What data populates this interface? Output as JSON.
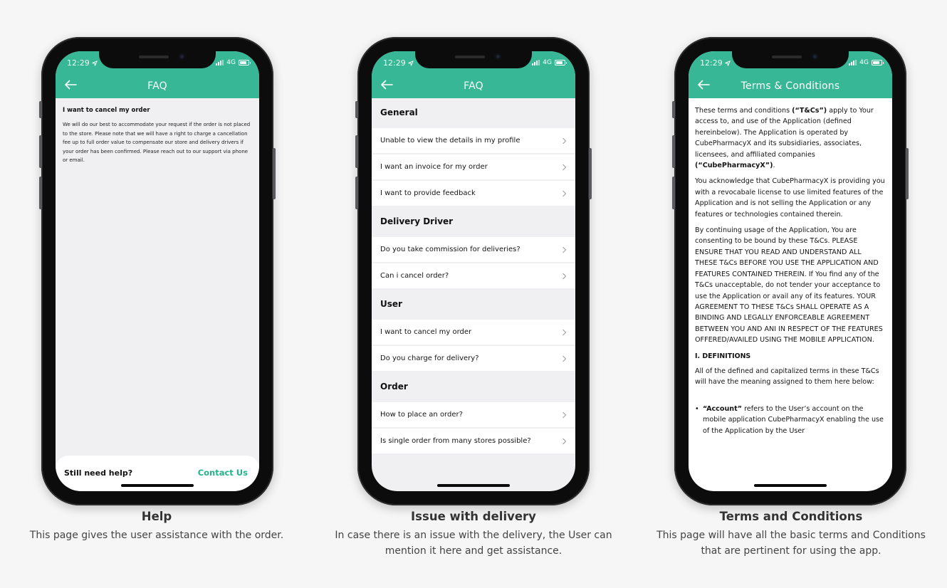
{
  "colors": {
    "accent": "#37b796",
    "contact_link": "#26b389",
    "page_bg": "#f6f6f6",
    "list_bg": "#f0f0f2"
  },
  "status_bar": {
    "time": "12:29",
    "network": "4G"
  },
  "screens": {
    "help": {
      "title": "FAQ",
      "question": "I want to cancel my order",
      "answer": "We will do our best to accommodate your request if the order is not placed to the store. Please note that we will have a right to charge a cancellation fee up to full order value to compensate our store and delivery drivers if your order has been confirmed. Please reach out to our support via phone or email.",
      "footer_text": "Still need help?",
      "contact_label": "Contact Us"
    },
    "faq": {
      "title": "FAQ",
      "sections": [
        {
          "title": "General",
          "items": [
            "Unable to view the details in my profile",
            "I want an invoice for my order",
            "I want to provide feedback"
          ]
        },
        {
          "title": "Delivery Driver",
          "items": [
            "Do you take commission for deliveries?",
            "Can i cancel order?"
          ]
        },
        {
          "title": "User",
          "items": [
            "I want to cancel my order",
            "Do you charge for delivery?"
          ]
        },
        {
          "title": "Order",
          "items": [
            "How to place an order?",
            "Is single order from many stores possible?"
          ]
        }
      ]
    },
    "terms": {
      "title": "Terms & Conditions",
      "p1_a": "These terms and conditions ",
      "p1_b": "(“T&Cs”)",
      "p1_c": " apply to Your access to, and use of the Application (defined hereinbelow). The Application is operated by CubePharmacyX and its subsidiaries, associates, licensees, and affiliated companies ",
      "p1_d": "(“CubePharmacyX”)",
      "p1_e": ".",
      "p2": "You acknowledge that CubePharmacyX is providing you with a revocabale license to use limited features of the Application and is not selling the Application or any features or technologies contained therein.",
      "p3": "By continuing usage of the Application, You are consenting to be bound by these T&Cs. PLEASE ENSURE THAT YOU READ AND UNDERSTAND ALL THESE T&Cs BEFORE YOU USE THE APPLICATION AND FEATURES CONTAINED THEREIN. If You find any of the T&Cs unacceptable, do not tender your acceptance to use the Application or avail any of its features. YOUR AGREEMENT TO THESE T&Cs SHALL OPERATE AS A BINDING AND LEGALLY ENFORCEABLE AGREEMENT BETWEEN YOU AND ANI IN RESPECT OF THE FEATURES OFFERED/AVAILED USING THE MOBILE APPLICATION.",
      "definitions_heading": "I. DEFINITIONS",
      "p4": "All of the defined and capitalized terms in these T&Cs will have the meaning assigned to them here below:",
      "bullet_term": "“Account”",
      "bullet_text": " refers to the User’s account on the mobile application CubePharmacyX enabling the use of the Application by the User"
    }
  },
  "captions": [
    {
      "title": "Help",
      "text": "This page gives the user assistance with the order."
    },
    {
      "title": "Issue with delivery",
      "text": "In case there is an issue with the delivery, the User can mention it here and get assistance."
    },
    {
      "title": "Terms and Conditions",
      "text": "This page will have all the basic terms and Conditions that are pertinent for using the app."
    }
  ],
  "icons": {
    "back": "arrow-left-icon",
    "chevron": "chevron-right-icon",
    "location": "location-arrow-icon",
    "signal": "signal-icon",
    "battery": "battery-icon"
  }
}
